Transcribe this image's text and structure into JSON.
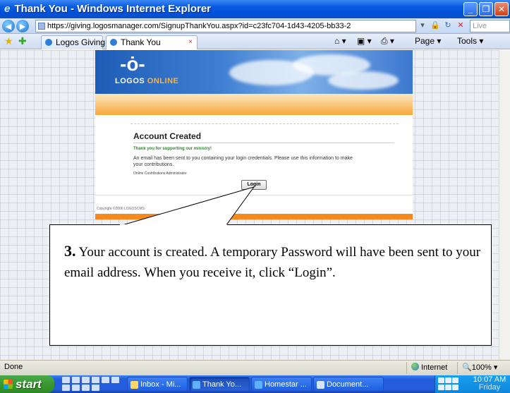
{
  "window": {
    "title": "Thank You - Windows Internet Explorer",
    "controls": {
      "minimize": "_",
      "maximize": "❐",
      "close": "✕"
    }
  },
  "address_bar": {
    "url": "https://giving.logosmanager.com/SignupThankYou.aspx?id=c23fc704-1d43-4205-bb33-2",
    "search_placeholder": "Live Search"
  },
  "tabs": [
    {
      "label": "Logos Giving"
    },
    {
      "label": "Thank You"
    }
  ],
  "command_bar": {
    "page_label": "Page ▾",
    "tools_label": "Tools ▾"
  },
  "page": {
    "logo": {
      "sun": "-ȯ-",
      "brand": "LOGOS",
      "brand_accent": "ONLINE"
    },
    "heading": "Account Created",
    "thanks": "Thank you for supporting our ministry!",
    "email_message": "An email has been sent to you containing your login credentials. Please use this information to make your contributions.",
    "admin": "Online Contributions Administrator",
    "login_button": "Login",
    "copyright": "Copyright ©2006 LOGOSCMS"
  },
  "callout": {
    "step": "3.",
    "text": " Your account is created. A temporary Password will have been sent to your email address.  When you receive it, click “Login”."
  },
  "status_bar": {
    "status": "Done",
    "zone": "Internet",
    "zoom": "100%"
  },
  "taskbar": {
    "start_label": "start",
    "tasks": [
      {
        "label": "Inbox - Mi..."
      },
      {
        "label": "Thank Yo..."
      },
      {
        "label": "Homestar ..."
      },
      {
        "label": "Document..."
      }
    ],
    "clock_time": "10:07 AM",
    "clock_day": "Friday"
  },
  "colors": {
    "titlebar": "#0050d8",
    "banner_orange": "#f58a1f",
    "start_green": "#38982f",
    "thanks_green": "#2a8a2a"
  }
}
